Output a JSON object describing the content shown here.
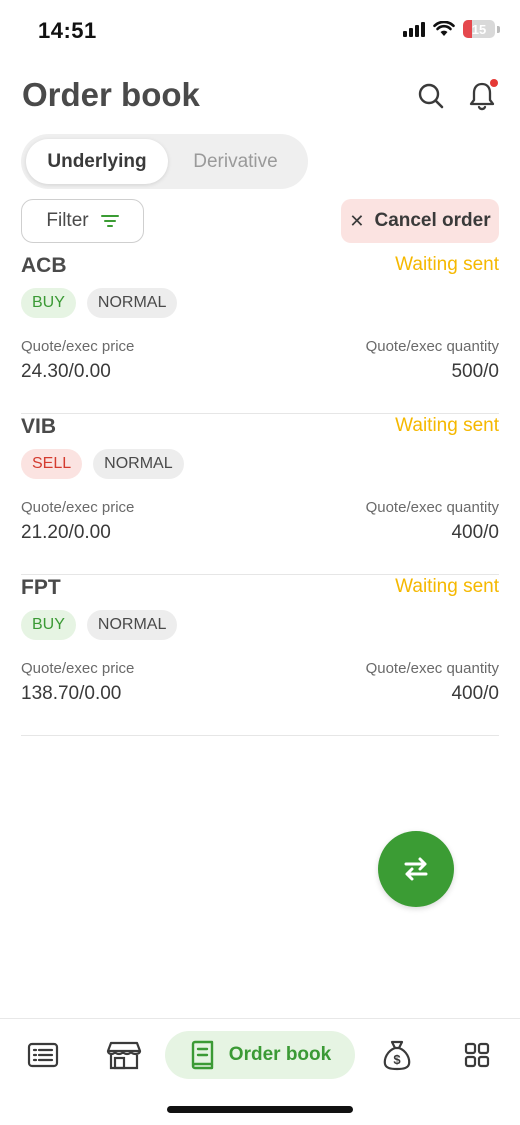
{
  "status_bar": {
    "time": "14:51",
    "battery": "15"
  },
  "header": {
    "title": "Order book"
  },
  "tabs": [
    {
      "label": "Underlying",
      "active": true
    },
    {
      "label": "Derivative",
      "active": false
    }
  ],
  "actions": {
    "filter_label": "Filter",
    "cancel_label": "Cancel order"
  },
  "orders": [
    {
      "symbol": "ACB",
      "status": "Waiting sent",
      "side": "BUY",
      "type": "NORMAL",
      "price_label": "Quote/exec price",
      "price": "24.30/0.00",
      "qty_label": "Quote/exec quantity",
      "qty": "500/0"
    },
    {
      "symbol": "VIB",
      "status": "Waiting sent",
      "side": "SELL",
      "type": "NORMAL",
      "price_label": "Quote/exec price",
      "price": "21.20/0.00",
      "qty_label": "Quote/exec quantity",
      "qty": "400/0"
    },
    {
      "symbol": "FPT",
      "status": "Waiting sent",
      "side": "BUY",
      "type": "NORMAL",
      "price_label": "Quote/exec price",
      "price": "138.70/0.00",
      "qty_label": "Quote/exec quantity",
      "qty": "400/0"
    }
  ],
  "bottom_nav": {
    "items": [
      {
        "icon": "list-icon"
      },
      {
        "icon": "store-icon"
      },
      {
        "icon": "book-icon",
        "label": "Order book",
        "active": true
      },
      {
        "icon": "money-bag-icon"
      },
      {
        "icon": "grid-icon"
      }
    ]
  },
  "colors": {
    "accent": "#3b9c34",
    "status_waiting": "#f5b800",
    "sell": "#d43b2f",
    "cancel_bg": "#fbe3e1"
  }
}
